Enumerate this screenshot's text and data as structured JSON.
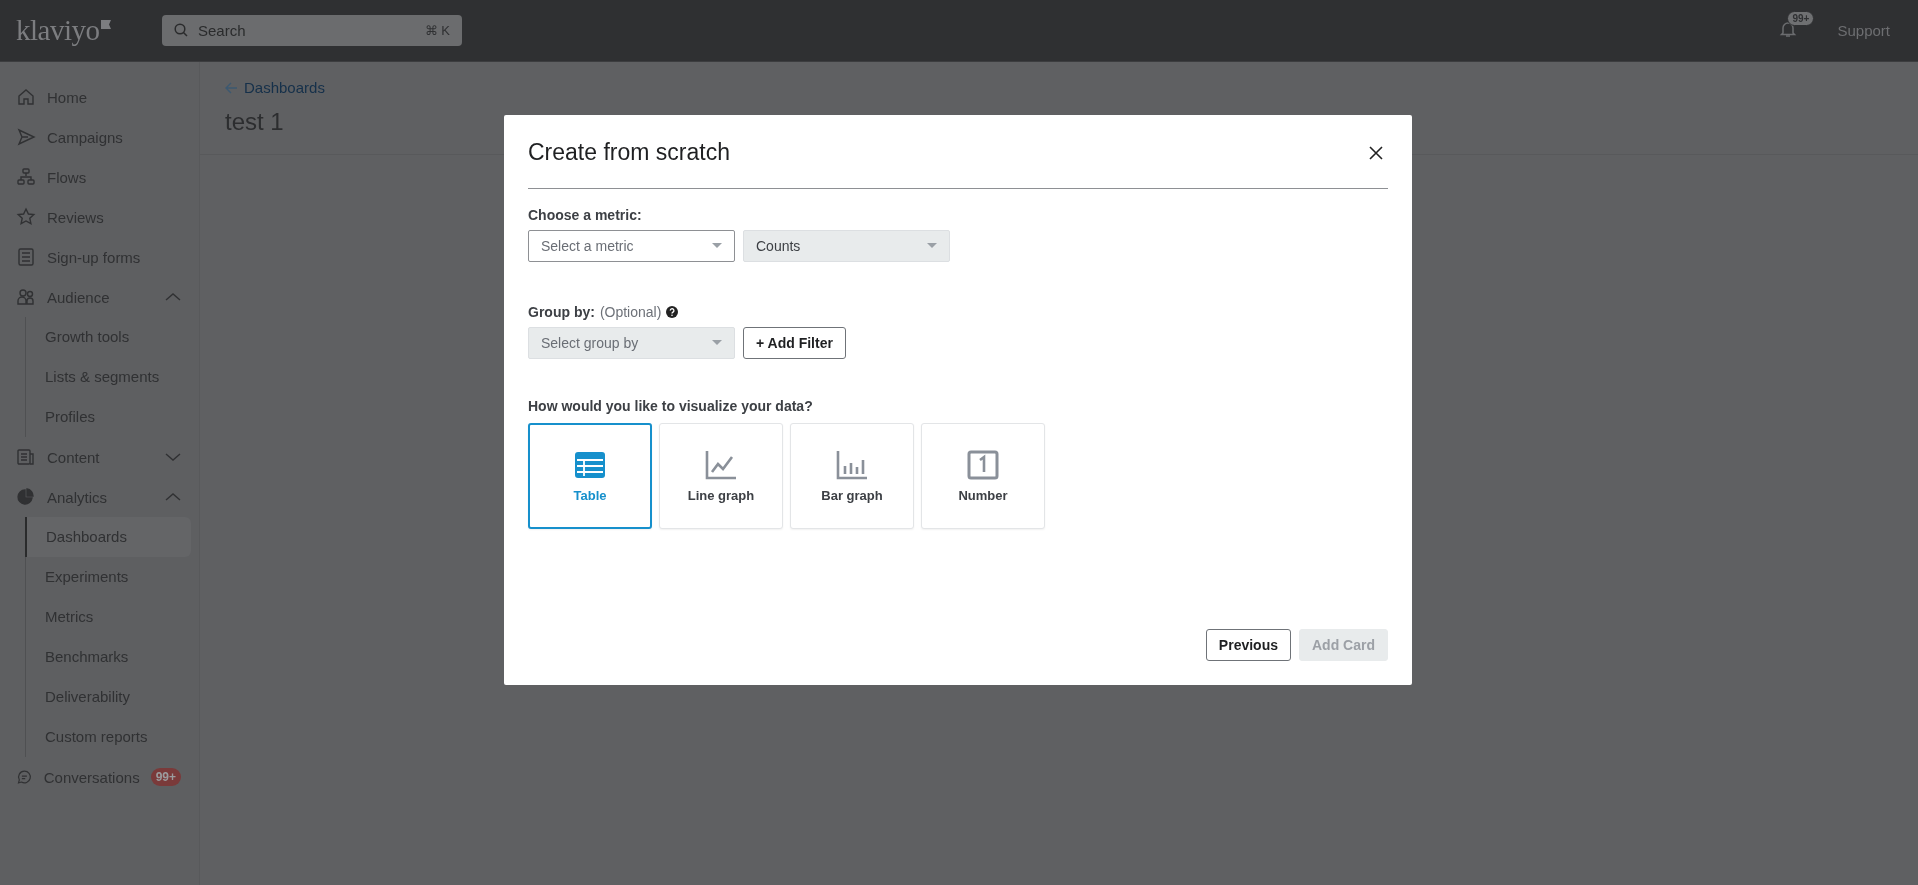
{
  "topbar": {
    "logo": "klaviyo",
    "search": {
      "placeholder": "Search",
      "shortcut": "⌘ K"
    },
    "notifications_badge": "99+",
    "support": "Support"
  },
  "sidebar": {
    "items": [
      {
        "label": "Home",
        "selected": false
      },
      {
        "label": "Campaigns",
        "selected": false
      },
      {
        "label": "Flows",
        "selected": false
      },
      {
        "label": "Reviews",
        "selected": false
      },
      {
        "label": "Sign-up forms",
        "selected": false
      },
      {
        "label": "Audience",
        "selected": false,
        "expanded": true,
        "children": [
          {
            "label": "Growth tools",
            "selected": false
          },
          {
            "label": "Lists & segments",
            "selected": false
          },
          {
            "label": "Profiles",
            "selected": false
          }
        ]
      },
      {
        "label": "Content",
        "selected": false,
        "expanded": false
      },
      {
        "label": "Analytics",
        "selected": false,
        "expanded": true,
        "children": [
          {
            "label": "Dashboards",
            "selected": true
          },
          {
            "label": "Experiments",
            "selected": false
          },
          {
            "label": "Metrics",
            "selected": false
          },
          {
            "label": "Benchmarks",
            "selected": false
          },
          {
            "label": "Deliverability",
            "selected": false
          },
          {
            "label": "Custom reports",
            "selected": false
          }
        ]
      },
      {
        "label": "Conversations",
        "selected": false,
        "badge": "99+"
      }
    ]
  },
  "page": {
    "back_link": "Dashboards",
    "title": "test 1"
  },
  "modal": {
    "title": "Create from scratch",
    "metric_label": "Choose a metric:",
    "metric_select": {
      "placeholder": "Select a metric",
      "disabled": false
    },
    "measure_select": {
      "value": "Counts",
      "disabled": true
    },
    "group_label": "Group by:",
    "group_optional": "(Optional)",
    "group_select": {
      "placeholder": "Select group by",
      "disabled": true
    },
    "add_filter": "+ Add Filter",
    "visualize_label": "How would you like to visualize your data?",
    "visualizations": [
      {
        "kind": "table",
        "label": "Table",
        "selected": true
      },
      {
        "kind": "line",
        "label": "Line graph",
        "selected": false
      },
      {
        "kind": "bar",
        "label": "Bar graph",
        "selected": false
      },
      {
        "kind": "number",
        "label": "Number",
        "selected": false
      }
    ],
    "buttons": [
      {
        "label": "Previous",
        "disabled": false
      },
      {
        "label": "Add Card",
        "disabled": true
      }
    ]
  }
}
